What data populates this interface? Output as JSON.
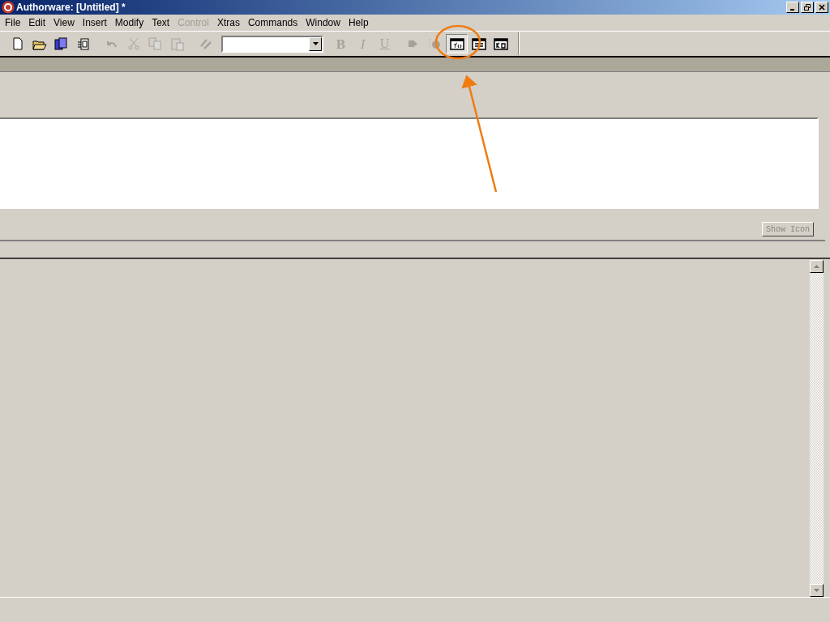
{
  "window": {
    "title": "Authorware: [Untitled] *"
  },
  "menu": [
    {
      "label": "File",
      "disabled": false
    },
    {
      "label": "Edit",
      "disabled": false
    },
    {
      "label": "View",
      "disabled": false
    },
    {
      "label": "Insert",
      "disabled": false
    },
    {
      "label": "Modify",
      "disabled": false
    },
    {
      "label": "Text",
      "disabled": false
    },
    {
      "label": "Control",
      "disabled": true
    },
    {
      "label": "Xtras",
      "disabled": false
    },
    {
      "label": "Commands",
      "disabled": false
    },
    {
      "label": "Window",
      "disabled": false
    },
    {
      "label": "Help",
      "disabled": false
    }
  ],
  "toolbar": [
    {
      "kind": "new",
      "disabled": false,
      "pressed": false
    },
    {
      "kind": "open",
      "disabled": false,
      "pressed": false
    },
    {
      "kind": "save",
      "disabled": false,
      "pressed": false
    },
    {
      "kind": "import",
      "disabled": false,
      "pressed": false
    },
    {
      "kind": "gap"
    },
    {
      "kind": "undo",
      "disabled": true,
      "pressed": false
    },
    {
      "kind": "cut",
      "disabled": true,
      "pressed": false
    },
    {
      "kind": "copy",
      "disabled": true,
      "pressed": false
    },
    {
      "kind": "paste",
      "disabled": true,
      "pressed": false
    },
    {
      "kind": "gap"
    },
    {
      "kind": "find",
      "disabled": true,
      "pressed": false
    },
    {
      "kind": "font"
    },
    {
      "kind": "bold",
      "glyph": "B",
      "disabled": true,
      "pressed": false
    },
    {
      "kind": "italic",
      "glyph": "I",
      "disabled": true,
      "pressed": false
    },
    {
      "kind": "underline",
      "glyph": "U",
      "disabled": true,
      "pressed": false
    },
    {
      "kind": "gap"
    },
    {
      "kind": "run",
      "disabled": true,
      "pressed": false
    },
    {
      "kind": "control",
      "disabled": true,
      "pressed": false
    },
    {
      "kind": "functions",
      "disabled": false,
      "pressed": true
    },
    {
      "kind": "variables",
      "disabled": false,
      "pressed": false
    },
    {
      "kind": "knowledge",
      "disabled": false,
      "pressed": false
    }
  ],
  "show_icon_button": {
    "label": "Show Icon",
    "disabled": true
  }
}
